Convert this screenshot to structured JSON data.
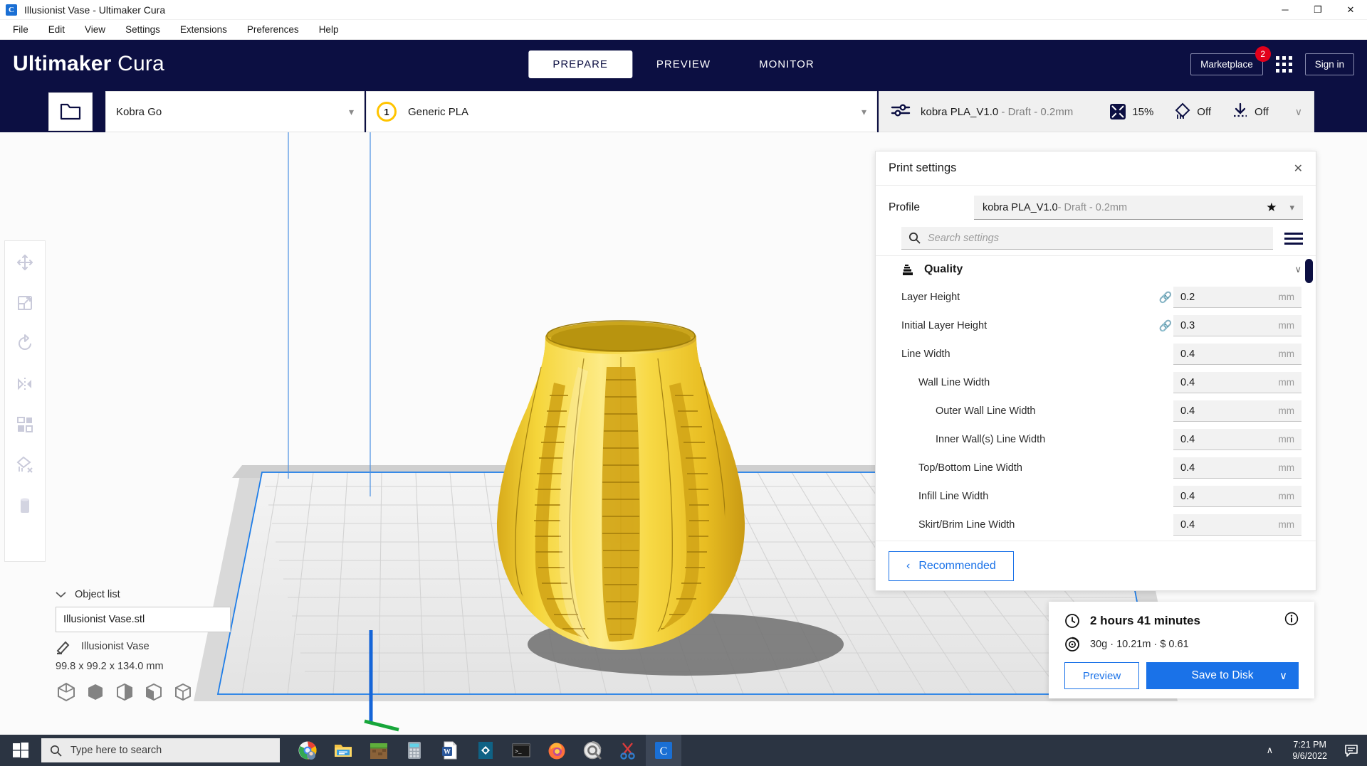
{
  "window": {
    "title": "Illusionist Vase - Ultimaker Cura",
    "app_icon": "cura-icon",
    "minimize": "─",
    "maximize": "❐",
    "close": "✕"
  },
  "menubar": {
    "items": [
      "File",
      "Edit",
      "View",
      "Settings",
      "Extensions",
      "Preferences",
      "Help"
    ]
  },
  "header": {
    "logo_bold": "Ultimaker",
    "logo_light": "Cura",
    "stages": [
      {
        "label": "PREPARE",
        "active": true
      },
      {
        "label": "PREVIEW",
        "active": false
      },
      {
        "label": "MONITOR",
        "active": false
      }
    ],
    "marketplace_label": "Marketplace",
    "marketplace_badge": "2",
    "plugins_icon": "app-grid-icon",
    "signin_label": "Sign in",
    "accent_dark": "#0c0f42",
    "badge_color": "#e3001b"
  },
  "machinebar": {
    "open_file_icon": "folder-open-icon",
    "printer": "Kobra Go",
    "extruder_number": "1",
    "material": "Generic PLA",
    "profile_icon": "sliders-icon",
    "profile_name": "kobra PLA_V1.0",
    "profile_suffix": " - Draft - 0.2mm",
    "infill_icon": "infill-icon",
    "infill_value": "15%",
    "support_icon": "support-icon",
    "support_value": "Off",
    "adhesion_icon": "adhesion-icon",
    "adhesion_value": "Off",
    "expand_chevron": "∨"
  },
  "toolbar": {
    "tools": [
      {
        "name": "move-tool",
        "icon": "move-icon"
      },
      {
        "name": "scale-tool",
        "icon": "scale-icon"
      },
      {
        "name": "rotate-tool",
        "icon": "rotate-icon"
      },
      {
        "name": "mirror-tool",
        "icon": "mirror-icon"
      },
      {
        "name": "per-model-settings-tool",
        "icon": "per-model-icon"
      },
      {
        "name": "support-blocker-tool",
        "icon": "support-blocker-icon"
      },
      {
        "name": "delete-tool",
        "icon": "trash-icon"
      }
    ]
  },
  "object_list": {
    "header": "Object list",
    "collapse_icon": "chevron-down-icon",
    "file_name": "Illusionist Vase.stl",
    "edit_icon": "pencil-icon",
    "model_name": "Illusionist Vase",
    "dimensions": "99.8 x 99.2 x 134.0 mm",
    "view_icons": [
      "solid-view-icon",
      "cube-filled-icon",
      "cube-xray-icon",
      "cube-half-icon",
      "cube-outline-icon"
    ]
  },
  "print_settings": {
    "title": "Print settings",
    "close_icon": "close-icon",
    "profile_label": "Profile",
    "profile_value": "kobra PLA_V1.0",
    "profile_suffix": " - Draft - 0.2mm",
    "favorite_icon": "star-icon",
    "dropdown_icon": "chevron-down-icon",
    "search_icon": "search-icon",
    "search_placeholder": "Search settings",
    "search_value": "",
    "menu_icon": "settings-visibility-icon",
    "category": {
      "name": "Quality",
      "icon": "quality-icon",
      "chevron": "∨"
    },
    "settings": [
      {
        "name": "Layer Height",
        "indent": 0,
        "linked": true,
        "value": "0.2",
        "unit": "mm"
      },
      {
        "name": "Initial Layer Height",
        "indent": 0,
        "linked": true,
        "value": "0.3",
        "unit": "mm"
      },
      {
        "name": "Line Width",
        "indent": 0,
        "linked": false,
        "value": "0.4",
        "unit": "mm"
      },
      {
        "name": "Wall Line Width",
        "indent": 1,
        "linked": false,
        "value": "0.4",
        "unit": "mm"
      },
      {
        "name": "Outer Wall Line Width",
        "indent": 2,
        "linked": false,
        "value": "0.4",
        "unit": "mm"
      },
      {
        "name": "Inner Wall(s) Line Width",
        "indent": 2,
        "linked": false,
        "value": "0.4",
        "unit": "mm"
      },
      {
        "name": "Top/Bottom Line Width",
        "indent": 1,
        "linked": false,
        "value": "0.4",
        "unit": "mm"
      },
      {
        "name": "Infill Line Width",
        "indent": 1,
        "linked": false,
        "value": "0.4",
        "unit": "mm"
      },
      {
        "name": "Skirt/Brim Line Width",
        "indent": 1,
        "linked": false,
        "value": "0.4",
        "unit": "mm"
      }
    ],
    "recommended_label": "Recommended",
    "recommended_chevron": "‹"
  },
  "print_job": {
    "time_icon": "clock-icon",
    "time": "2 hours 41 minutes",
    "info_icon": "info-icon",
    "spool_icon": "spool-icon",
    "material_cost": "30g · 10.21m · $ 0.61",
    "preview_label": "Preview",
    "save_label": "Save to Disk",
    "save_chevron": "∨",
    "primary_color": "#1a72e8"
  },
  "taskbar": {
    "start_icon": "windows-start-icon",
    "search_icon": "search-icon",
    "search_placeholder": "Type here to search",
    "apps": [
      {
        "name": "chrome",
        "active": false
      },
      {
        "name": "file-explorer",
        "active": false
      },
      {
        "name": "minecraft",
        "active": false
      },
      {
        "name": "calculator",
        "active": false
      },
      {
        "name": "word",
        "active": false
      },
      {
        "name": "photos",
        "active": false
      },
      {
        "name": "terminal",
        "active": false
      },
      {
        "name": "firefox",
        "active": false
      },
      {
        "name": "tuneup",
        "active": false
      },
      {
        "name": "snip-sketch",
        "active": false
      },
      {
        "name": "cura",
        "active": true
      }
    ],
    "tray_chevron": "∧",
    "time": "7:21 PM",
    "date": "9/6/2022",
    "notification_icon": "notification-icon"
  },
  "viewport": {
    "model_color": "#f2cf2e",
    "plate_color": "#e8e8e8",
    "outline_color": "#1e7de8"
  }
}
